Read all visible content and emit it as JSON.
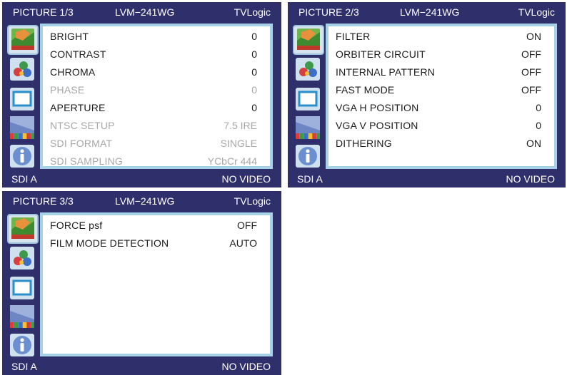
{
  "common": {
    "model": "LVM−241WG",
    "brand": "TVLogic",
    "input": "SDI A",
    "status": "NO VIDEO"
  },
  "screens": [
    {
      "page": "PICTURE 1/3",
      "items": [
        {
          "label": "BRIGHT",
          "value": "0",
          "enabled": true
        },
        {
          "label": "CONTRAST",
          "value": "0",
          "enabled": true
        },
        {
          "label": "CHROMA",
          "value": "0",
          "enabled": true
        },
        {
          "label": "PHASE",
          "value": "0",
          "enabled": false
        },
        {
          "label": "APERTURE",
          "value": "0",
          "enabled": true
        },
        {
          "label": "NTSC SETUP",
          "value": "7.5 IRE",
          "enabled": false
        },
        {
          "label": "SDI FORMAT",
          "value": "SINGLE",
          "enabled": false
        },
        {
          "label": "SDI SAMPLING",
          "value": "YCbCr 444",
          "enabled": false
        }
      ]
    },
    {
      "page": "PICTURE 2/3",
      "items": [
        {
          "label": "FILTER",
          "value": "ON",
          "enabled": true
        },
        {
          "label": "ORBITER CIRCUIT",
          "value": "OFF",
          "enabled": true
        },
        {
          "label": "INTERNAL PATTERN",
          "value": "OFF",
          "enabled": true
        },
        {
          "label": "FAST MODE",
          "value": "OFF",
          "enabled": true
        },
        {
          "label": "VGA H POSITION",
          "value": "0",
          "enabled": true
        },
        {
          "label": "VGA V POSITION",
          "value": "0",
          "enabled": true
        },
        {
          "label": "DITHERING",
          "value": "ON",
          "enabled": true
        }
      ]
    },
    {
      "page": "PICTURE 3/3",
      "items": [
        {
          "label": "FORCE psf",
          "value": "OFF",
          "enabled": true
        },
        {
          "label": "FILM MODE DETECTION",
          "value": "AUTO",
          "enabled": true
        }
      ]
    }
  ],
  "icons": [
    "picture-icon",
    "color-icon",
    "display-icon",
    "pattern-icon",
    "info-icon"
  ]
}
